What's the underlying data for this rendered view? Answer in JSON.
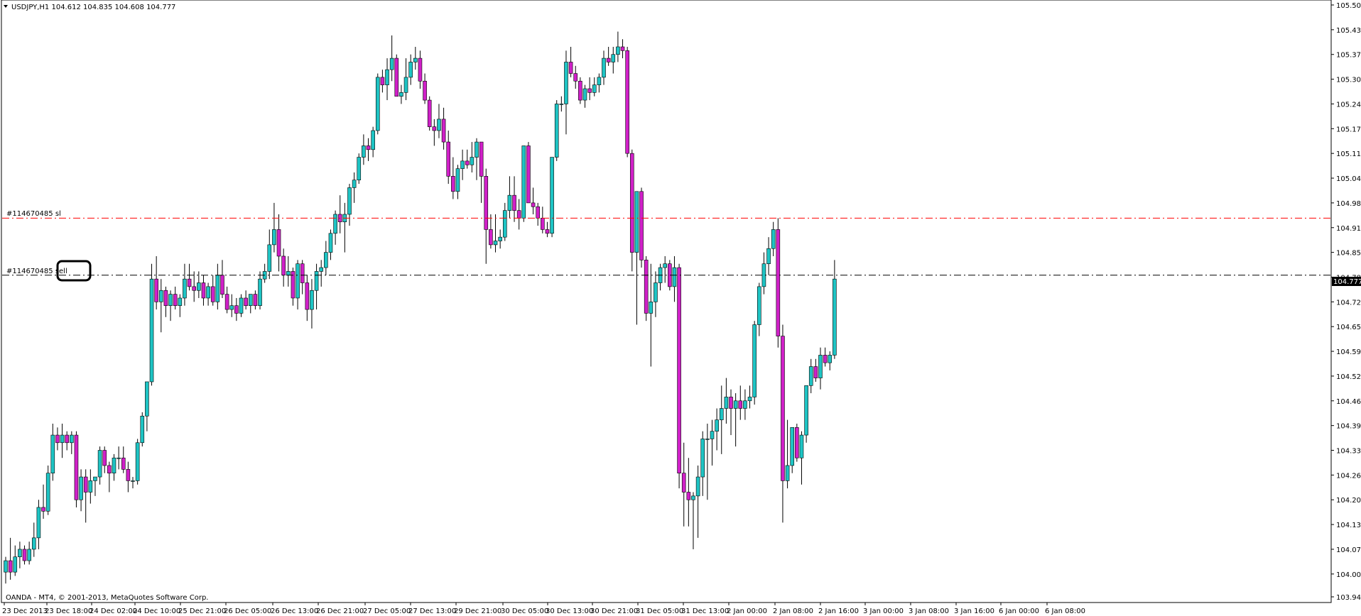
{
  "window": {
    "header_text": "USDJPY,H1  104.612 104.835 104.608 104.777",
    "copyright": "OANDA - MT4, © 2001-2013, MetaQuotes Software Corp."
  },
  "colors": {
    "bull": "#1ec4c4",
    "bear": "#d020c8",
    "wick": "#000000",
    "stop_loss_line": "#ff0000",
    "order_line": "#000000",
    "price_tag_bg": "#000000",
    "price_tag_fg": "#ffffff"
  },
  "annotations": {
    "sl_label": "#114670485 sl",
    "sell_label": "#114670485 sell"
  },
  "chart_data": {
    "type": "candlestick",
    "symbol": "USDJPY",
    "timeframe": "H1",
    "header": {
      "open": 104.612,
      "high": 104.835,
      "low": 104.608,
      "close": 104.777
    },
    "current_price": "104.777",
    "ylim": [
      103.945,
      105.5
    ],
    "y_ticks": [
      "105.500",
      "105.435",
      "105.370",
      "105.305",
      "105.240",
      "105.175",
      "105.110",
      "105.045",
      "104.980",
      "104.915",
      "104.850",
      "104.785",
      "104.720",
      "104.655",
      "104.590",
      "104.525",
      "104.460",
      "104.395",
      "104.330",
      "104.265",
      "104.200",
      "104.135",
      "104.070",
      "104.005",
      "103.945"
    ],
    "x_ticks": [
      "23 Dec 2013",
      "23 Dec 18:00",
      "24 Dec 02:00",
      "24 Dec 10:00",
      "25 Dec 21:00",
      "26 Dec 05:00",
      "26 Dec 13:00",
      "26 Dec 21:00",
      "27 Dec 05:00",
      "27 Dec 13:00",
      "29 Dec 21:00",
      "30 Dec 05:00",
      "30 Dec 13:00",
      "30 Dec 21:00",
      "31 Dec 05:00",
      "31 Dec 13:00",
      "2 Jan 00:00",
      "2 Jan 08:00",
      "2 Jan 16:00",
      "3 Jan 00:00",
      "3 Jan 08:00",
      "3 Jan 16:00",
      "6 Jan 00:00",
      "6 Jan 08:00"
    ],
    "lines": [
      {
        "name": "#114670485 sl",
        "price": 104.94
      },
      {
        "name": "#114670485 sell",
        "price": 104.79
      }
    ],
    "candles": [
      [
        104.01,
        104.05,
        103.98,
        104.04
      ],
      [
        104.04,
        104.1,
        103.99,
        104.01
      ],
      [
        104.01,
        104.08,
        104.0,
        104.05
      ],
      [
        104.05,
        104.09,
        104.02,
        104.07
      ],
      [
        104.07,
        104.08,
        104.03,
        104.04
      ],
      [
        104.04,
        104.09,
        104.03,
        104.07
      ],
      [
        104.07,
        104.14,
        104.05,
        104.1
      ],
      [
        104.1,
        104.2,
        104.07,
        104.18
      ],
      [
        104.18,
        104.24,
        104.15,
        104.17
      ],
      [
        104.17,
        104.29,
        104.16,
        104.27
      ],
      [
        104.27,
        104.4,
        104.25,
        104.37
      ],
      [
        104.37,
        104.39,
        104.33,
        104.35
      ],
      [
        104.35,
        104.4,
        104.31,
        104.37
      ],
      [
        104.37,
        104.38,
        104.33,
        104.35
      ],
      [
        104.35,
        104.38,
        104.32,
        104.37
      ],
      [
        104.37,
        104.38,
        104.18,
        104.2
      ],
      [
        104.2,
        104.28,
        104.17,
        104.26
      ],
      [
        104.26,
        104.28,
        104.14,
        104.22
      ],
      [
        104.22,
        104.28,
        104.19,
        104.25
      ],
      [
        104.25,
        104.26,
        104.21,
        104.26
      ],
      [
        104.26,
        104.34,
        104.24,
        104.33
      ],
      [
        104.33,
        104.34,
        104.27,
        104.29
      ],
      [
        104.29,
        104.3,
        104.22,
        104.27
      ],
      [
        104.27,
        104.32,
        104.25,
        104.31
      ],
      [
        104.31,
        104.34,
        104.28,
        104.31
      ],
      [
        104.31,
        104.34,
        104.27,
        104.28
      ],
      [
        104.28,
        104.3,
        104.22,
        104.25
      ],
      [
        104.25,
        104.26,
        104.23,
        104.25
      ],
      [
        104.25,
        104.36,
        104.24,
        104.35
      ],
      [
        104.35,
        104.43,
        104.34,
        104.42
      ],
      [
        104.42,
        104.47,
        104.38,
        104.51
      ],
      [
        104.51,
        104.82,
        104.5,
        104.78
      ],
      [
        104.78,
        104.84,
        104.7,
        104.72
      ],
      [
        104.72,
        104.78,
        104.64,
        104.75
      ],
      [
        104.75,
        104.76,
        104.68,
        104.71
      ],
      [
        104.71,
        104.75,
        104.67,
        104.74
      ],
      [
        104.74,
        104.76,
        104.7,
        104.71
      ],
      [
        104.71,
        104.74,
        104.68,
        104.73
      ],
      [
        104.73,
        104.82,
        104.71,
        104.78
      ],
      [
        104.78,
        104.82,
        104.75,
        104.76
      ],
      [
        104.76,
        104.8,
        104.72,
        104.75
      ],
      [
        104.75,
        104.8,
        104.73,
        104.77
      ],
      [
        104.77,
        104.79,
        104.71,
        104.73
      ],
      [
        104.73,
        104.77,
        104.71,
        104.76
      ],
      [
        104.76,
        104.79,
        104.71,
        104.72
      ],
      [
        104.72,
        104.82,
        104.7,
        104.79
      ],
      [
        104.79,
        104.83,
        104.73,
        104.74
      ],
      [
        104.74,
        104.76,
        104.69,
        104.7
      ],
      [
        104.7,
        104.74,
        104.68,
        104.71
      ],
      [
        104.71,
        104.73,
        104.67,
        104.69
      ],
      [
        104.69,
        104.74,
        104.68,
        104.73
      ],
      [
        104.73,
        104.75,
        104.7,
        104.71
      ],
      [
        104.71,
        104.74,
        104.69,
        104.74
      ],
      [
        104.74,
        104.75,
        104.7,
        104.71
      ],
      [
        104.71,
        104.8,
        104.7,
        104.78
      ],
      [
        104.78,
        104.82,
        104.77,
        104.8
      ],
      [
        104.8,
        104.91,
        104.78,
        104.87
      ],
      [
        104.87,
        104.98,
        104.85,
        104.91
      ],
      [
        104.91,
        104.95,
        104.8,
        104.84
      ],
      [
        104.84,
        104.86,
        104.76,
        104.79
      ],
      [
        104.79,
        104.84,
        104.76,
        104.8
      ],
      [
        104.8,
        104.81,
        104.71,
        104.73
      ],
      [
        104.73,
        104.83,
        104.7,
        104.82
      ],
      [
        104.82,
        104.83,
        104.74,
        104.77
      ],
      [
        104.77,
        104.79,
        104.67,
        104.7
      ],
      [
        104.7,
        104.78,
        104.65,
        104.75
      ],
      [
        104.75,
        104.82,
        104.7,
        104.8
      ],
      [
        104.8,
        104.83,
        104.76,
        104.81
      ],
      [
        104.81,
        104.88,
        104.79,
        104.85
      ],
      [
        104.85,
        104.91,
        104.83,
        104.9
      ],
      [
        104.9,
        104.96,
        104.87,
        104.95
      ],
      [
        104.95,
        105.0,
        104.9,
        104.93
      ],
      [
        104.93,
        104.98,
        104.85,
        104.95
      ],
      [
        104.95,
        105.03,
        104.92,
        105.02
      ],
      [
        105.02,
        105.06,
        104.98,
        105.04
      ],
      [
        105.04,
        105.11,
        105.03,
        105.1
      ],
      [
        105.1,
        105.16,
        105.08,
        105.13
      ],
      [
        105.13,
        105.15,
        105.09,
        105.12
      ],
      [
        105.12,
        105.18,
        105.1,
        105.17
      ],
      [
        105.17,
        105.32,
        105.16,
        105.31
      ],
      [
        105.31,
        105.33,
        105.27,
        105.29
      ],
      [
        105.29,
        105.36,
        105.25,
        105.33
      ],
      [
        105.33,
        105.42,
        105.3,
        105.36
      ],
      [
        105.36,
        105.37,
        105.27,
        105.26
      ],
      [
        105.26,
        105.29,
        105.24,
        105.27
      ],
      [
        105.27,
        105.36,
        105.25,
        105.31
      ],
      [
        105.31,
        105.37,
        105.29,
        105.35
      ],
      [
        105.35,
        105.39,
        105.33,
        105.36
      ],
      [
        105.36,
        105.38,
        105.28,
        105.3
      ],
      [
        105.3,
        105.32,
        105.24,
        105.25
      ],
      [
        105.25,
        105.26,
        105.17,
        105.18
      ],
      [
        105.18,
        105.2,
        105.13,
        105.17
      ],
      [
        105.17,
        105.24,
        105.15,
        105.2
      ],
      [
        105.2,
        105.23,
        105.12,
        105.14
      ],
      [
        105.14,
        105.17,
        105.03,
        105.05
      ],
      [
        105.05,
        105.1,
        104.99,
        105.01
      ],
      [
        105.01,
        105.08,
        104.99,
        105.07
      ],
      [
        105.07,
        105.12,
        105.04,
        105.09
      ],
      [
        105.09,
        105.12,
        105.07,
        105.08
      ],
      [
        105.08,
        105.14,
        105.06,
        105.1
      ],
      [
        105.1,
        105.15,
        105.04,
        105.14
      ],
      [
        105.14,
        105.14,
        104.98,
        105.05
      ],
      [
        105.05,
        105.07,
        104.82,
        104.91
      ],
      [
        104.91,
        104.95,
        104.86,
        104.87
      ],
      [
        104.87,
        104.95,
        104.85,
        104.88
      ],
      [
        104.88,
        104.91,
        104.86,
        104.89
      ],
      [
        104.89,
        104.98,
        104.88,
        104.96
      ],
      [
        104.96,
        105.05,
        104.94,
        105.0
      ],
      [
        105.0,
        105.05,
        104.93,
        104.96
      ],
      [
        104.96,
        104.99,
        104.91,
        104.94
      ],
      [
        104.94,
        105.13,
        104.93,
        105.13
      ],
      [
        105.13,
        105.14,
        104.98,
        104.98
      ],
      [
        104.98,
        105.02,
        104.95,
        104.97
      ],
      [
        104.97,
        104.98,
        104.92,
        104.94
      ],
      [
        104.94,
        104.97,
        104.9,
        104.91
      ],
      [
        104.91,
        104.93,
        104.89,
        104.9
      ],
      [
        104.9,
        105.1,
        104.89,
        105.1
      ],
      [
        105.1,
        105.25,
        105.09,
        105.24
      ],
      [
        105.24,
        105.26,
        105.22,
        105.24
      ],
      [
        105.24,
        105.38,
        105.16,
        105.35
      ],
      [
        105.35,
        105.39,
        105.31,
        105.32
      ],
      [
        105.32,
        105.34,
        105.28,
        105.3
      ],
      [
        105.3,
        105.31,
        105.24,
        105.25
      ],
      [
        105.25,
        105.29,
        105.23,
        105.28
      ],
      [
        105.28,
        105.31,
        105.25,
        105.27
      ],
      [
        105.27,
        105.31,
        105.26,
        105.29
      ],
      [
        105.29,
        105.32,
        105.27,
        105.31
      ],
      [
        105.31,
        105.38,
        105.29,
        105.36
      ],
      [
        105.36,
        105.39,
        105.34,
        105.35
      ],
      [
        105.35,
        105.39,
        105.32,
        105.37
      ],
      [
        105.37,
        105.43,
        105.35,
        105.39
      ],
      [
        105.39,
        105.41,
        105.36,
        105.38
      ],
      [
        105.38,
        105.39,
        105.1,
        105.11
      ],
      [
        105.11,
        105.12,
        104.8,
        104.85
      ],
      [
        104.85,
        105.01,
        104.66,
        105.01
      ],
      [
        105.01,
        105.02,
        104.81,
        104.83
      ],
      [
        104.83,
        104.84,
        104.67,
        104.69
      ],
      [
        104.69,
        104.82,
        104.55,
        104.72
      ],
      [
        104.72,
        104.8,
        104.68,
        104.77
      ],
      [
        104.77,
        104.82,
        104.75,
        104.81
      ],
      [
        104.81,
        104.84,
        104.77,
        104.82
      ],
      [
        104.82,
        104.83,
        104.75,
        104.76
      ],
      [
        104.76,
        104.84,
        104.72,
        104.81
      ],
      [
        104.81,
        104.82,
        104.23,
        104.27
      ],
      [
        104.27,
        104.35,
        104.13,
        104.22
      ],
      [
        104.22,
        104.31,
        104.13,
        104.2
      ],
      [
        104.2,
        104.22,
        104.07,
        104.21
      ],
      [
        104.21,
        104.29,
        104.1,
        104.26
      ],
      [
        104.26,
        104.38,
        104.21,
        104.36
      ],
      [
        104.36,
        104.4,
        104.2,
        104.36
      ],
      [
        104.36,
        104.41,
        104.29,
        104.38
      ],
      [
        104.38,
        104.44,
        104.33,
        104.41
      ],
      [
        104.41,
        104.5,
        104.32,
        104.44
      ],
      [
        104.44,
        104.52,
        104.4,
        104.47
      ],
      [
        104.47,
        104.49,
        104.37,
        104.44
      ],
      [
        104.44,
        104.48,
        104.34,
        104.46
      ],
      [
        104.46,
        104.5,
        104.41,
        104.44
      ],
      [
        104.44,
        104.49,
        104.41,
        104.46
      ],
      [
        104.46,
        104.5,
        104.44,
        104.47
      ],
      [
        104.47,
        104.67,
        104.45,
        104.66
      ],
      [
        104.66,
        104.77,
        104.63,
        104.76
      ],
      [
        104.76,
        104.85,
        104.74,
        104.82
      ],
      [
        104.82,
        104.89,
        104.79,
        104.86
      ],
      [
        104.86,
        104.93,
        104.84,
        104.91
      ],
      [
        104.91,
        104.94,
        104.6,
        104.63
      ],
      [
        104.63,
        104.66,
        104.14,
        104.25
      ],
      [
        104.25,
        104.41,
        104.23,
        104.29
      ],
      [
        104.29,
        104.39,
        104.27,
        104.39
      ],
      [
        104.39,
        104.4,
        104.3,
        104.31
      ],
      [
        104.31,
        104.38,
        104.24,
        104.37
      ],
      [
        104.37,
        104.49,
        104.35,
        104.5
      ],
      [
        104.5,
        104.57,
        104.48,
        104.55
      ],
      [
        104.55,
        104.57,
        104.51,
        104.52
      ],
      [
        104.52,
        104.6,
        104.49,
        104.58
      ],
      [
        104.58,
        104.6,
        104.55,
        104.56
      ],
      [
        104.56,
        104.59,
        104.54,
        104.58
      ],
      [
        104.58,
        104.83,
        104.57,
        104.78
      ]
    ]
  }
}
